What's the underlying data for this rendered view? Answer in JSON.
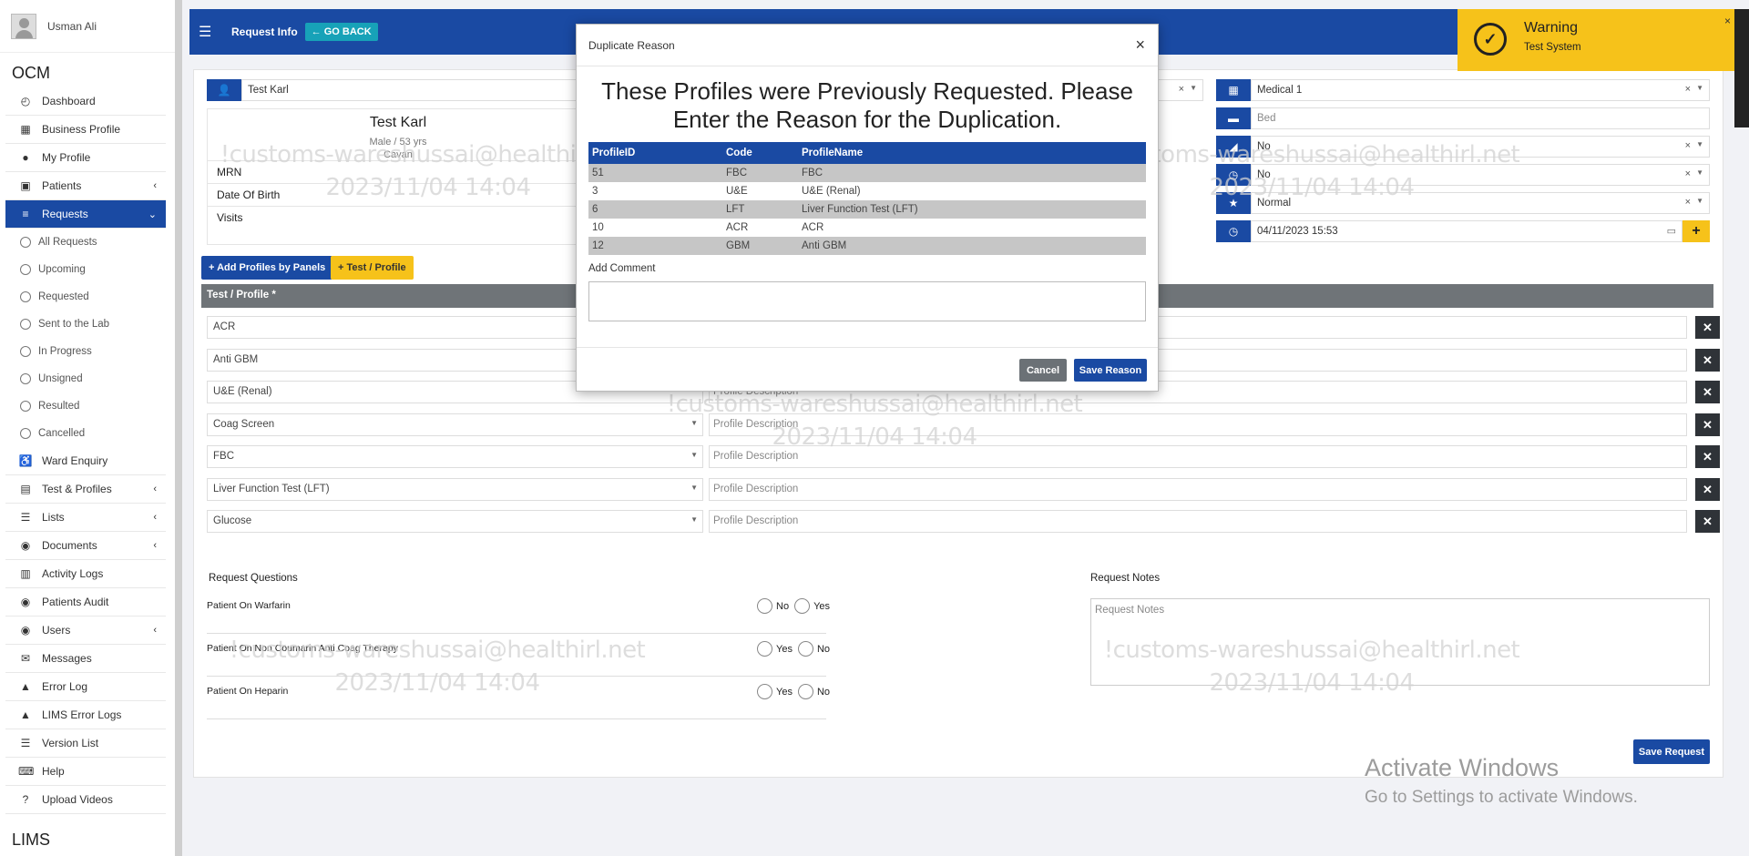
{
  "sidebar": {
    "user_name": "Usman Ali",
    "brand_top": "OCM",
    "brand_bottom": "LIMS",
    "items": [
      {
        "label": "Dashboard",
        "icon": "dashboard-icon",
        "glyph": "◴",
        "caret": ""
      },
      {
        "label": "Business Profile",
        "icon": "building-icon",
        "glyph": "▦",
        "caret": ""
      },
      {
        "label": "My Profile",
        "icon": "user-icon",
        "glyph": "●",
        "caret": ""
      },
      {
        "label": "Patients",
        "icon": "hospital-icon",
        "glyph": "▣",
        "caret": "‹"
      },
      {
        "label": "Requests",
        "icon": "database-icon",
        "glyph": "≡",
        "caret": "⌄"
      },
      {
        "label": "All Requests"
      },
      {
        "label": "Upcoming"
      },
      {
        "label": "Requested"
      },
      {
        "label": "Sent to the Lab"
      },
      {
        "label": "In Progress"
      },
      {
        "label": "Unsigned"
      },
      {
        "label": "Resulted"
      },
      {
        "label": "Cancelled"
      },
      {
        "label": "Ward Enquiry",
        "icon": "wheelchair-icon",
        "glyph": "♿",
        "caret": ""
      },
      {
        "label": "Test & Profiles",
        "icon": "flask-icon",
        "glyph": "▤",
        "caret": "‹"
      },
      {
        "label": "Lists",
        "icon": "list-icon",
        "glyph": "☰",
        "caret": "‹"
      },
      {
        "label": "Documents",
        "icon": "users-icon",
        "glyph": "◉",
        "caret": "‹"
      },
      {
        "label": "Activity Logs",
        "icon": "bank-icon",
        "glyph": "▥",
        "caret": ""
      },
      {
        "label": "Patients Audit",
        "icon": "users-icon",
        "glyph": "◉",
        "caret": ""
      },
      {
        "label": "Users",
        "icon": "users-icon",
        "glyph": "◉",
        "caret": "‹"
      },
      {
        "label": "Messages",
        "icon": "envelope-icon",
        "glyph": "✉",
        "caret": ""
      },
      {
        "label": "Error Log",
        "icon": "warning-icon",
        "glyph": "▲",
        "caret": ""
      },
      {
        "label": "LIMS Error Logs",
        "icon": "warning-icon",
        "glyph": "▲",
        "caret": ""
      },
      {
        "label": "Version List",
        "icon": "list-icon",
        "glyph": "☰",
        "caret": ""
      },
      {
        "label": "Help",
        "icon": "keyboard-icon",
        "glyph": "⌨",
        "caret": ""
      },
      {
        "label": "Upload Videos",
        "icon": "question-icon",
        "glyph": "?",
        "caret": ""
      }
    ]
  },
  "topbar": {
    "title": "Request Info",
    "back_label": "← GO BACK"
  },
  "patient": {
    "select_value": "Test Karl",
    "name": "Test Karl",
    "sex_age": "Male / 53 yrs",
    "location": "Cavan",
    "fields": [
      "MRN",
      "Date Of Birth",
      "Visits"
    ]
  },
  "right_fields": {
    "ward": "Medical 1",
    "bed_placeholder": "Bed",
    "field3": "No",
    "field4": "No",
    "priority": "Normal",
    "datetime": "04/11/2023 15:53"
  },
  "buttons": {
    "add_panels": "+ Add Profiles by Panels",
    "test_profile": "+ Test / Profile",
    "save_request": "Save Request"
  },
  "tests": {
    "header": "Test / Profile *",
    "desc_placeholder": "Profile Description",
    "desc_partial": "Profile Description",
    "rows": [
      "ACR",
      "Anti GBM",
      "U&E (Renal)",
      "Coag Screen",
      "FBC",
      "Liver Function Test (LFT)",
      "Glucose"
    ]
  },
  "questions": {
    "title": "Request Questions",
    "items": [
      {
        "q": "Patient On Warfarin",
        "opt1": "No",
        "opt2": "Yes"
      },
      {
        "q": "Patient On Non Coumarin Anti Coag Therapy",
        "opt1": "Yes",
        "opt2": "No"
      },
      {
        "q": "Patient On Heparin",
        "opt1": "Yes",
        "opt2": "No"
      }
    ]
  },
  "notes": {
    "title": "Request Notes",
    "placeholder": "Request Notes"
  },
  "modal": {
    "title": "Duplicate Reason",
    "message": "These Profiles were Previously Requested. Please Enter the Reason for the Duplication.",
    "columns": [
      "ProfileID",
      "Code",
      "ProfileName"
    ],
    "rows": [
      [
        "51",
        "FBC",
        "FBC"
      ],
      [
        "3",
        "U&E",
        "U&E (Renal)"
      ],
      [
        "6",
        "LFT",
        "Liver Function Test (LFT)"
      ],
      [
        "10",
        "ACR",
        "ACR"
      ],
      [
        "12",
        "GBM",
        "Anti GBM"
      ]
    ],
    "comment_label": "Add Comment",
    "cancel": "Cancel",
    "save": "Save Reason"
  },
  "toast": {
    "title": "Warning",
    "message": "Test System"
  },
  "watermark": {
    "line1": "!customs-wareshussai@healthirl.net",
    "line2": "2023/11/04 14:04"
  },
  "activate": {
    "line1": "Activate Windows",
    "line2": "Go to Settings to activate Windows."
  },
  "colors": {
    "primary": "#1a4aa3",
    "warning": "#f6c21a",
    "info": "#17a2b8"
  }
}
